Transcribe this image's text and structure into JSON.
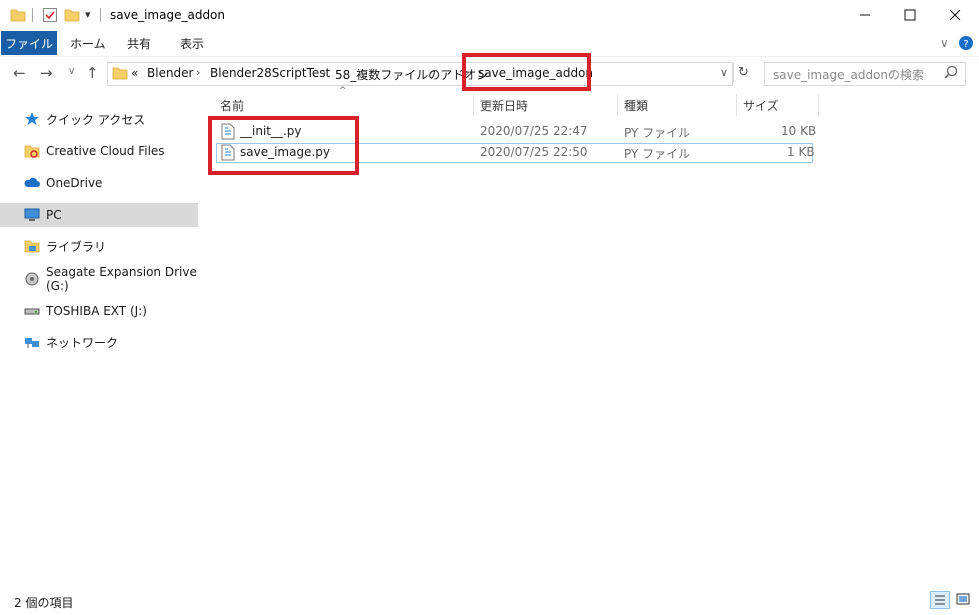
{
  "window": {
    "title": "save_image_addon",
    "controls": [
      "minimize-icon",
      "maximize-icon",
      "close-icon"
    ]
  },
  "ribbon": {
    "tabs": [
      "ファイル",
      "ホーム",
      "共有",
      "表示"
    ]
  },
  "address": {
    "overflow": "«",
    "crumbs": [
      "Blender",
      "Blender28ScriptTest",
      "58_複数ファイルのアドオン",
      "save_image_addon"
    ]
  },
  "search": {
    "placeholder": "save_image_addonの検索"
  },
  "nav": {
    "items": [
      {
        "label": "クイック アクセス",
        "icon": "star-pin-icon"
      },
      {
        "label": "Creative Cloud Files",
        "icon": "creative-cloud-folder-icon"
      },
      {
        "label": "OneDrive",
        "icon": "cloud-icon"
      },
      {
        "label": "PC",
        "icon": "monitor-icon"
      },
      {
        "label": "ライブラリ",
        "icon": "library-icon"
      },
      {
        "label": "Seagate Expansion Drive (G:)",
        "icon": "external-drive-icon"
      },
      {
        "label": "TOSHIBA EXT (J:)",
        "icon": "drive-icon"
      },
      {
        "label": "ネットワーク",
        "icon": "network-icon"
      }
    ],
    "selected": "PC"
  },
  "columns": [
    "名前",
    "更新日時",
    "種類",
    "サイズ"
  ],
  "files": [
    {
      "name": "__init__.py",
      "modified": "2020/07/25 22:47",
      "type": "PY ファイル",
      "size": "10 KB"
    },
    {
      "name": "save_image.py",
      "modified": "2020/07/25 22:50",
      "type": "PY ファイル",
      "size": "1 KB"
    }
  ],
  "status": {
    "count_text": "2 個の項目"
  },
  "colors": {
    "accent": "#1a5fa6",
    "highlight_box": "#d7222c",
    "selection_border": "#99c9ef"
  }
}
